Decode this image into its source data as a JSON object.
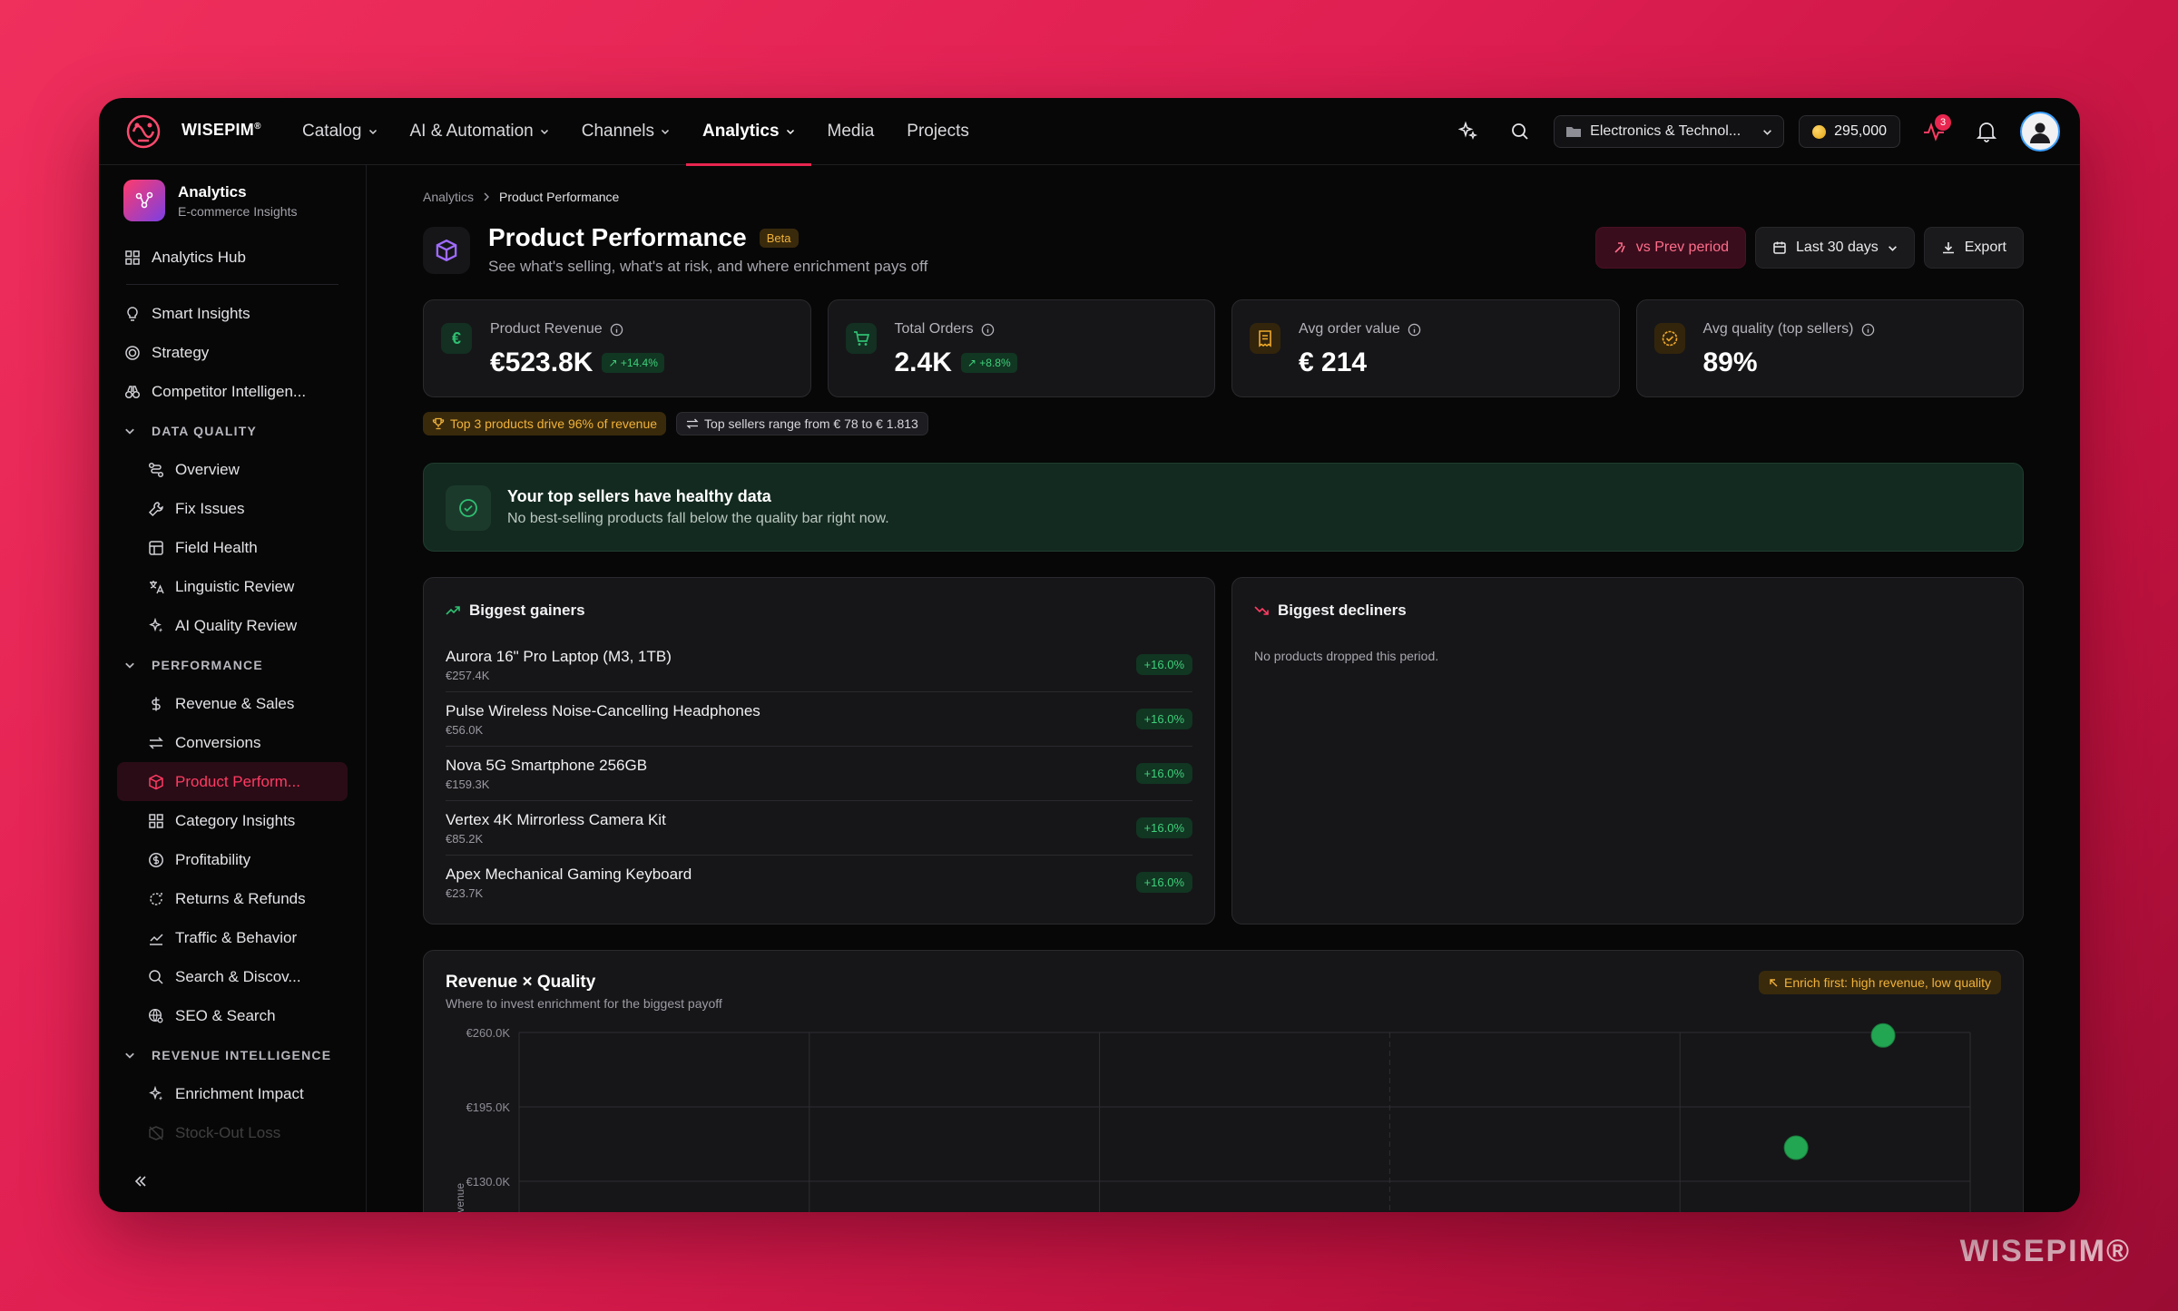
{
  "brand": {
    "name": "WISEPIM",
    "mark": "®",
    "watermark": "WISEPIM®"
  },
  "nav": {
    "items": [
      {
        "label": "Catalog",
        "dropdown": true,
        "active": false
      },
      {
        "label": "AI & Automation",
        "dropdown": true,
        "active": false
      },
      {
        "label": "Channels",
        "dropdown": true,
        "active": false
      },
      {
        "label": "Analytics",
        "dropdown": true,
        "active": true
      },
      {
        "label": "Media",
        "dropdown": false,
        "active": false
      },
      {
        "label": "Projects",
        "dropdown": false,
        "active": false
      }
    ],
    "workspace": "Electronics & Technol...",
    "credits": "295,000",
    "activity_count": "3"
  },
  "sidebar": {
    "title": "Analytics",
    "subtitle": "E-commerce Insights",
    "hub": "Analytics Hub",
    "top_items": [
      "Smart Insights",
      "Strategy",
      "Competitor Intelligen..."
    ],
    "groups": [
      {
        "label": "DATA QUALITY",
        "items": [
          "Overview",
          "Fix Issues",
          "Field Health",
          "Linguistic Review",
          "AI Quality Review"
        ]
      },
      {
        "label": "PERFORMANCE",
        "items": [
          "Revenue & Sales",
          "Conversions",
          "Product Perform...",
          "Category Insights",
          "Profitability",
          "Returns & Refunds",
          "Traffic & Behavior",
          "Search & Discov...",
          "SEO & Search"
        ]
      },
      {
        "label": "REVENUE INTELLIGENCE",
        "items": [
          "Enrichment Impact",
          "Stock-Out Loss"
        ]
      }
    ],
    "active_item": "Product Perform..."
  },
  "breadcrumb": {
    "parent": "Analytics",
    "current": "Product Performance"
  },
  "page": {
    "title": "Product Performance",
    "badge": "Beta",
    "subtitle": "See what's selling, what's at risk, and where enrichment pays off",
    "compare_label": "vs Prev period",
    "range_label": "Last 30 days",
    "export_label": "Export"
  },
  "kpis": [
    {
      "label": "Product Revenue",
      "value": "€523.8K",
      "delta": "+14.4%",
      "icon": "euro-icon",
      "color": "#2fbf71"
    },
    {
      "label": "Total Orders",
      "value": "2.4K",
      "delta": "+8.8%",
      "icon": "cart-icon",
      "color": "#2fbf71"
    },
    {
      "label": "Avg order value",
      "value": "€ 214",
      "delta": "",
      "icon": "receipt-icon",
      "color": "#f0a92a"
    },
    {
      "label": "Avg quality (top sellers)",
      "value": "89%",
      "delta": "",
      "icon": "check-badge-icon",
      "color": "#f0a92a"
    }
  ],
  "chips": {
    "top_products": "Top 3 products drive 96% of revenue",
    "range": "Top sellers range from € 78 to € 1.813"
  },
  "health_banner": {
    "title": "Your top sellers have healthy data",
    "subtitle": "No best-selling products fall below the quality bar right now."
  },
  "gainers": {
    "title": "Biggest gainers",
    "rows": [
      {
        "name": "Aurora 16\" Pro Laptop (M3, 1TB)",
        "value": "€257.4K",
        "delta": "+16.0%"
      },
      {
        "name": "Pulse Wireless Noise-Cancelling Headphones",
        "value": "€56.0K",
        "delta": "+16.0%"
      },
      {
        "name": "Nova 5G Smartphone 256GB",
        "value": "€159.3K",
        "delta": "+16.0%"
      },
      {
        "name": "Vertex 4K Mirrorless Camera Kit",
        "value": "€85.2K",
        "delta": "+16.0%"
      },
      {
        "name": "Apex Mechanical Gaming Keyboard",
        "value": "€23.7K",
        "delta": "+16.0%"
      }
    ]
  },
  "decliners": {
    "title": "Biggest decliners",
    "empty": "No products dropped this period."
  },
  "chart_data": {
    "type": "scatter",
    "title": "Revenue × Quality",
    "subtitle": "Where to invest enrichment for the biggest payoff",
    "annotation": "Enrich first: high revenue, low quality",
    "ylabel": "Revenue",
    "yticks": [
      "€260.0K",
      "€195.0K",
      "€130.0K"
    ],
    "ytick_values": [
      260,
      195,
      130
    ],
    "ylim": [
      130,
      260
    ],
    "xlim": [
      0,
      100
    ],
    "x_divider": 60,
    "grid": true,
    "series": [
      {
        "color": "#22a652",
        "points": [
          {
            "x": 94,
            "y": 257.4
          },
          {
            "x": 88,
            "y": 159.3
          }
        ]
      }
    ]
  }
}
